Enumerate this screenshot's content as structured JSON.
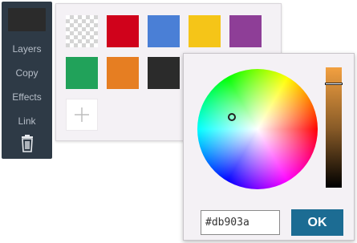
{
  "toolbar": {
    "current_color": "#2b2b2b",
    "items": [
      {
        "label": "Layers"
      },
      {
        "label": "Copy"
      },
      {
        "label": "Effects"
      },
      {
        "label": "Link"
      }
    ],
    "delete_icon": "trash-icon"
  },
  "palette": {
    "swatches": [
      {
        "name": "transparent",
        "color": "transparent"
      },
      {
        "name": "red",
        "color": "#d0021b"
      },
      {
        "name": "blue",
        "color": "#4a7fd6"
      },
      {
        "name": "yellow",
        "color": "#f5c518"
      },
      {
        "name": "purple",
        "color": "#8e3e97"
      },
      {
        "name": "green",
        "color": "#21a25a"
      },
      {
        "name": "orange",
        "color": "#e67e22"
      },
      {
        "name": "black",
        "color": "#2b2b2b"
      }
    ],
    "add_icon": "plus-icon"
  },
  "picker": {
    "hex_value": "#db903a",
    "ok_label": "OK"
  }
}
